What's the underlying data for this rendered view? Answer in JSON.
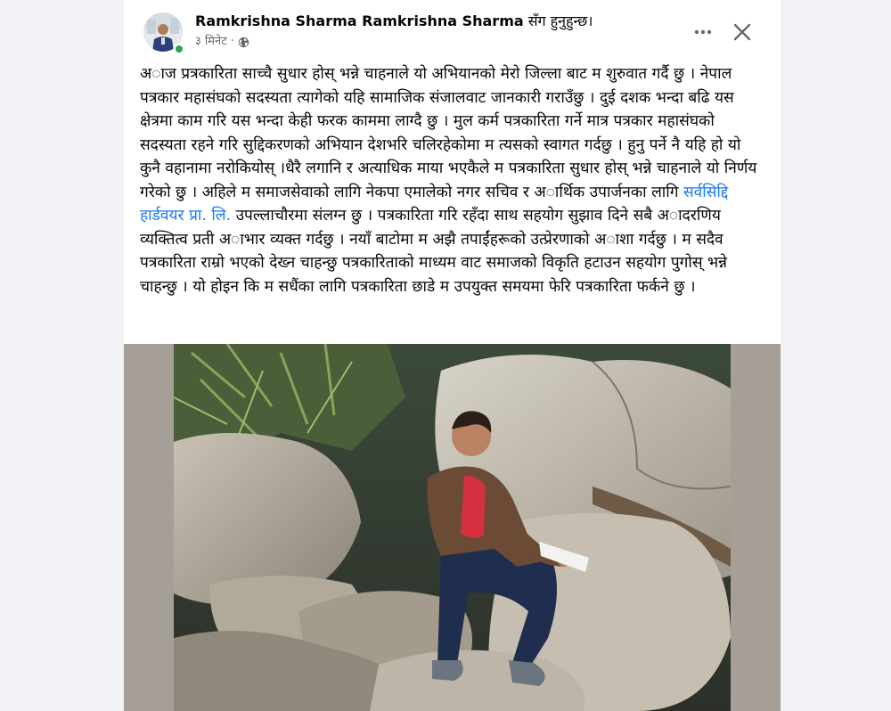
{
  "post": {
    "author": "Ramkrishna Sharma Ramkrishna Sharma",
    "author_suffix": "सँग हुनुहुन्छ।",
    "time": "३ मिनेट",
    "separator": "·",
    "privacy_icon": "globe-icon",
    "more_icon": "more-horizontal-icon",
    "close_icon": "close-icon",
    "body_part1": "अाज प्रत्रकारिता साच्चै सुधार होस् भन्ने चाहनाले यो अभियानको मेरो जिल्ला बाट म शुरुवात गर्दै छु । नेपाल पत्रकार महासंघको सदस्यता त्यागेको यहि सामाजिक संजालवाट जानकारी गराउँछु । दुई दशक भन्दा बढि यस क्षेत्रमा काम गरि यस भन्दा केही फरक काममा लाग्दै छु ।  मुल कर्म पत्रकारिता गर्ने मात्र पत्रकार महासंघको सदस्यता रहने गरि सुद्दिकरणको अभियान देशभरि चलिरहेकोमा म त्यसको स्वागत गर्दछु । हुनु पर्ने नै यहि हो यो कुनै वहानामा नरोकियोस् ।धैरै लगानि र अत्याधिक माया भएकैले म पत्रकारिता सुधार होस् भन्ने चाहनाले यो निर्णय गरेको छु । अहिले म समाजसेवाको लागि नेकपा एमालेको नगर सचिव र अार्थिक उपार्जनका लागि ",
    "body_link": "सर्वसिद्दि हार्डवयर प्रा. लि.",
    "body_part2": " उपल्लाचौरमा संलग्न छु । पत्रकारिता गरि रहँदा साथ सहयोग सुझाव दिने सबै अादरणिय व्यक्तित्व प्रती अाभार व्यक्त गर्दछु । नयाँ बाटोमा म अझै तपाईंहरूको उत्प्रेरणाको अाशा गर्दछु । म सदैव पत्रकारिता राम्रो भएको देख्न चाहन्छु पत्रकारिताको माध्यम वाट समाजको विकृति हटाउन सहयोग पुगोस् भन्ने चाहन्छु । यो होइन कि म सधैंका लागि पत्रकारिता छाडे म उपयुक्त समयमा फेरि पत्रकारिता फर्कने छु ।",
    "colors": {
      "link": "#1877f2",
      "online": "#31a24c",
      "meta": "#65676b",
      "photo_backdrop": "#a59f98"
    }
  }
}
